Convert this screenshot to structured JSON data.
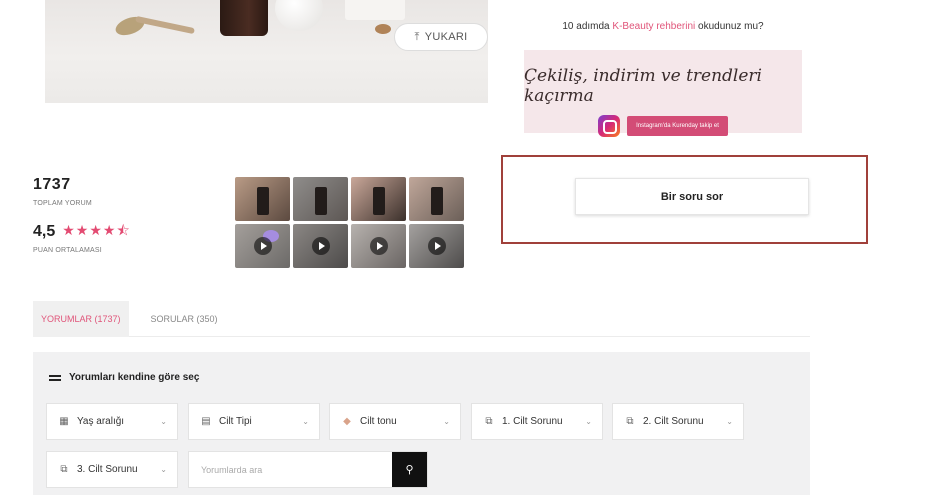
{
  "hero": {
    "scroll_top_label": "YUKARI"
  },
  "guide": {
    "prefix": "10 adımda ",
    "link": "K-Beauty rehberini",
    "suffix": " okudunuz mu?"
  },
  "promo": {
    "title": "Çekiliş, indirim ve trendleri kaçırma",
    "button": "Instagram'da Kurenday takip et"
  },
  "stats": {
    "total": "1737",
    "total_label": "TOPLAM YORUM",
    "average": "4,5",
    "stars": "★★★★⯪",
    "average_label": "PUAN ORTALAMASI"
  },
  "ask_button": "Bir soru sor",
  "tabs": [
    {
      "label": "YORUMLAR (1737)",
      "active": true
    },
    {
      "label": "SORULAR (350)",
      "active": false
    }
  ],
  "filters": {
    "title": "Yorumları kendine göre seç",
    "dropdowns": [
      {
        "label": "Yaş aralığı",
        "icon": "calendar-icon"
      },
      {
        "label": "Cilt Tipi",
        "icon": "skin-type-icon"
      },
      {
        "label": "Cilt tonu",
        "icon": "skin-tone-icon"
      },
      {
        "label": "1. Cilt Sorunu",
        "icon": "skin-problem-icon"
      },
      {
        "label": "2. Cilt Sorunu",
        "icon": "skin-problem-icon"
      },
      {
        "label": "3. Cilt Sorunu",
        "icon": "skin-problem-icon"
      }
    ],
    "search_placeholder": "Yorumlarda ara"
  },
  "colors": {
    "accent": "#e0557a",
    "highlight_border": "#a0403a",
    "panel_bg": "#f1f1f2"
  }
}
